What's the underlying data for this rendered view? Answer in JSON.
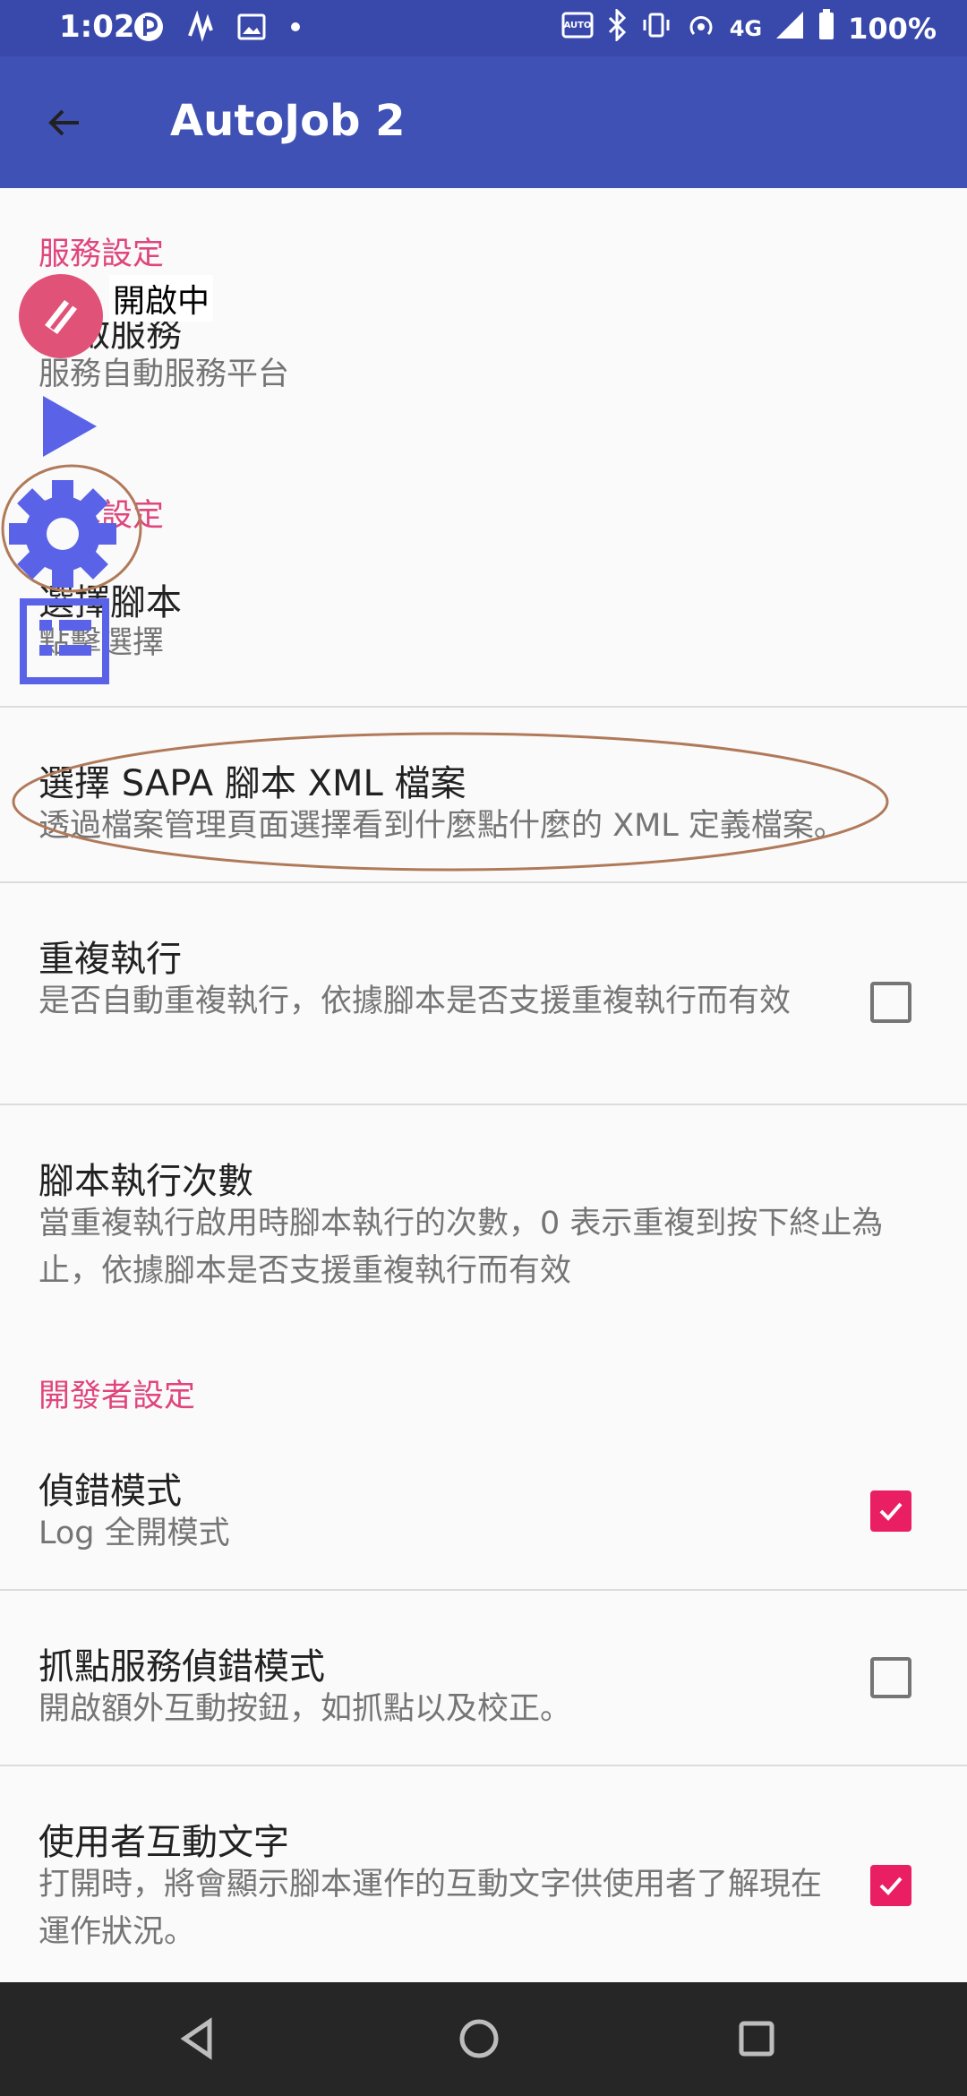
{
  "status_bar": {
    "time": "1:02",
    "network": "4G",
    "battery": "100%",
    "icons": [
      "signal-app-icon",
      "wave-icon",
      "image-icon",
      "dot-icon",
      "auto-hz-icon",
      "bluetooth-icon",
      "vibrate-icon",
      "hotspot-icon",
      "cell-signal-icon",
      "battery-icon"
    ]
  },
  "app_bar": {
    "title": "AutoJob 2",
    "back_icon": "arrow-left-icon"
  },
  "floating": {
    "status_label": "開啟中"
  },
  "sections": {
    "service": {
      "header": "服務設定",
      "service_pref_title": "開啟服務",
      "service_pref_summary": "服務自動服務平台"
    },
    "script": {
      "header": "腳本設定",
      "select_title": "選擇腳本",
      "select_summary": "點擊選擇",
      "sapa_title": "選擇 SAPA 腳本 XML 檔案",
      "sapa_summary": "透過檔案管理頁面選擇看到什麼點什麼的 XML 定義檔案。",
      "repeat_title": "重複執行",
      "repeat_summary": "是否自動重複執行，依據腳本是否支援重複執行而有效",
      "repeat_checked": false,
      "count_title": "腳本執行次數",
      "count_summary": "當重複執行啟用時腳本執行的次數，0 表示重複到按下終止為止，依據腳本是否支援重複執行而有效"
    },
    "developer": {
      "header": "開發者設定",
      "debug_title": "偵錯模式",
      "debug_summary": "Log 全開模式",
      "debug_checked": true,
      "grab_title": "抓點服務偵錯模式",
      "grab_summary": "開啟額外互動按鈕，如抓點以及校正。",
      "grab_checked": false,
      "interact_title": "使用者互動文字",
      "interact_summary": "打開時，將會顯示腳本運作的互動文字供使用者了解現在運作狀況。",
      "interact_checked": true
    }
  },
  "colors": {
    "primary": "#3f51b5",
    "status_bar": "#3949ab",
    "accent": "#e91e63",
    "section_header": "#e0457b",
    "floating_blue": "#5a63e8",
    "annotation_brown": "#b07a5a"
  }
}
